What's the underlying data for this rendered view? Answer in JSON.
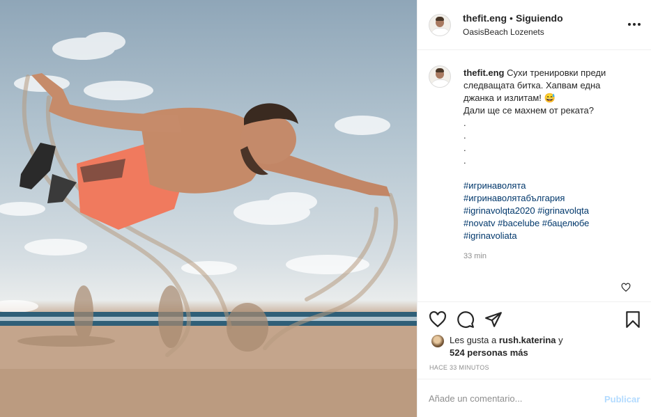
{
  "post": {
    "photo_alt": "Man diving horizontally on a beach with flying sand"
  },
  "header": {
    "username": "thefit.eng",
    "dot": "•",
    "follow_status": "Siguiendo",
    "location": "OasisBeach Lozenets",
    "more_icon": "more-horizontal-icon"
  },
  "caption": {
    "username": "thefit.eng",
    "lines": [
      "Сухи тренировки преди",
      "следващата битка. Хапвам една",
      "джанка и излитам! 😅",
      "Дали ще се махнем от реката?",
      ".",
      ".",
      ".",
      "."
    ],
    "hashtags": [
      "#игринаволята",
      "#игринаволятабългария"
    ],
    "hashtags_inline": [
      [
        "#igrinavolqta2020",
        "#igrinavolqta"
      ],
      [
        "#novatv",
        "#bacelube",
        "#бацелюбе"
      ]
    ],
    "hashtag_last": "#igrinavoliata",
    "time": "33 min"
  },
  "actions": {
    "like_icon": "heart-icon",
    "comment_icon": "comment-icon",
    "share_icon": "paper-plane-icon",
    "save_icon": "bookmark-icon"
  },
  "likes": {
    "prefix": "Les gusta a",
    "liker": "rush.katerina",
    "connector": "y",
    "count_text": "524 personas más"
  },
  "timestamp": "HACE 33 MINUTOS",
  "comment_box": {
    "placeholder": "Añade un comentario...",
    "publish_label": "Publicar",
    "publish_color": "#b3dbff"
  },
  "colors": {
    "hashtag": "#00376b",
    "secondary_text": "#8e8e8e",
    "primary_text": "#262626"
  }
}
